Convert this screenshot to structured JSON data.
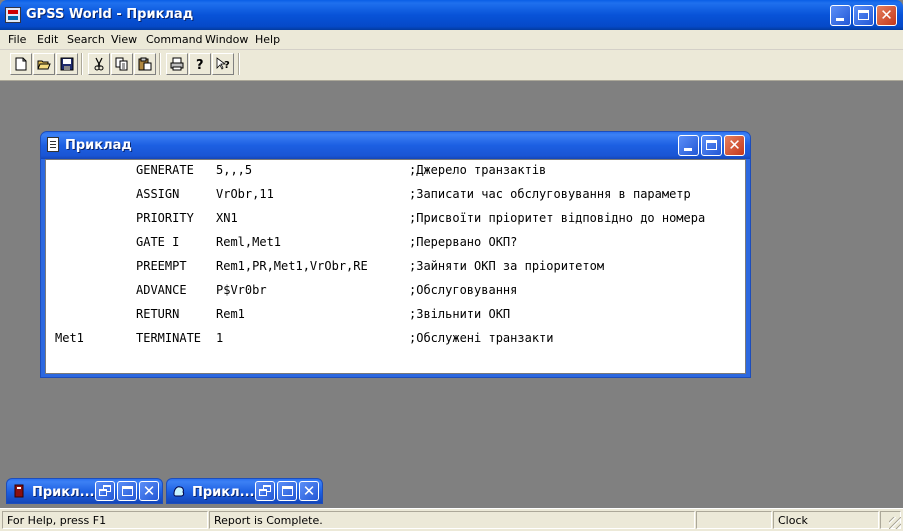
{
  "app": {
    "title": "GPSS World - Приклад",
    "icon": "gpss-app-icon"
  },
  "menu": [
    "File",
    "Edit",
    "Search",
    "View",
    "Command",
    "Window",
    "Help"
  ],
  "toolbar": {
    "buttons": [
      "new-file-icon",
      "open-folder-icon",
      "save-disk-icon",
      "cut-scissors-icon",
      "copy-icon",
      "paste-icon",
      "print-icon",
      "help-icon",
      "context-help-icon"
    ]
  },
  "model_window": {
    "title": "Приклад",
    "lines": [
      {
        "label": "",
        "op": "GENERATE",
        "args": "5,,,5",
        "comment": ";Джерело транзактів"
      },
      {
        "label": "",
        "op": "ASSIGN",
        "args": "VrObr,11",
        "comment": ";Записати час обслуговування в параметр"
      },
      {
        "label": "",
        "op": "PRIORITY",
        "args": "XN1",
        "comment": ";Присвоїти пріоритет відповідно до номера"
      },
      {
        "label": "",
        "op": "GATE I",
        "args": "Reml,Met1",
        "comment": ";Перервано ОКП?"
      },
      {
        "label": "",
        "op": "PREEMPT",
        "args": "Rem1,PR,Met1,VrObr,RE",
        "comment": ";Зайняти ОКП за пріоритетом"
      },
      {
        "label": "",
        "op": "ADVANCE",
        "args": "P$Vr0br",
        "comment": ";Обслуговування"
      },
      {
        "label": "",
        "op": "RETURN",
        "args": "Rem1",
        "comment": ";Звільнити ОКП"
      },
      {
        "label": "Met1",
        "op": "TERMINATE",
        "args": "1",
        "comment": ";Обслужені транзакти"
      }
    ]
  },
  "minimized": [
    {
      "title": "Прикл...",
      "icon": "simulation-icon"
    },
    {
      "title": "Прикл...",
      "icon": "report-icon"
    }
  ],
  "status": {
    "help": "For Help, press F1",
    "message": "Report is Complete.",
    "extra": "",
    "clock": "Clock",
    "last": ""
  }
}
